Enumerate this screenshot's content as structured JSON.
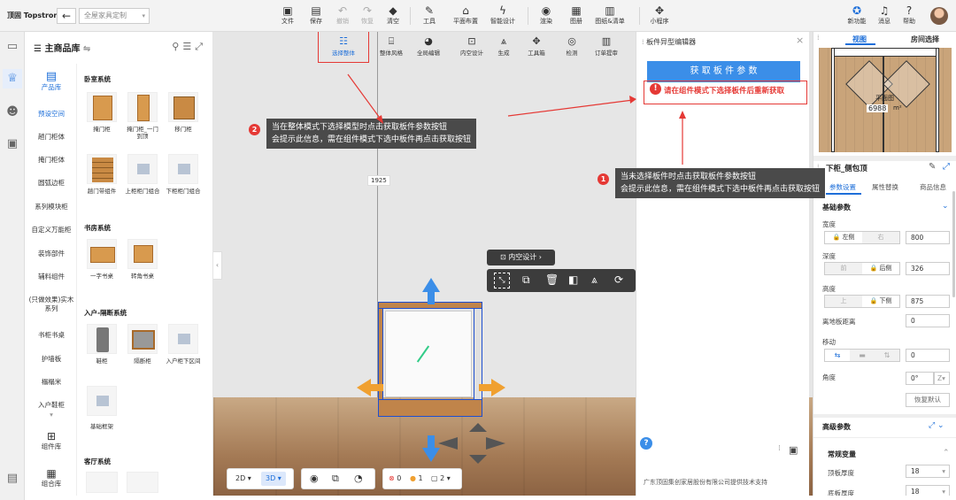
{
  "topbar": {
    "logo": "顶固 Topstrong",
    "back_icon": "arrow-left-icon",
    "plan_name": "全屋家具定制",
    "tools": [
      {
        "label": "文件",
        "icon": "file-icon"
      },
      {
        "label": "保存",
        "icon": "save-icon"
      },
      {
        "label": "撤销",
        "icon": "undo-icon"
      },
      {
        "label": "恢复",
        "icon": "redo-icon"
      },
      {
        "label": "清空",
        "icon": "eraser-icon"
      },
      {
        "label": "工具",
        "icon": "tool-icon"
      },
      {
        "label": "平面布置",
        "icon": "layout-icon"
      },
      {
        "label": "智能设计",
        "icon": "lightning-icon"
      },
      {
        "label": "渲染",
        "icon": "camera-icon"
      },
      {
        "label": "图册",
        "icon": "album-icon"
      },
      {
        "label": "图纸&清单",
        "icon": "drawing-icon"
      },
      {
        "label": "小程序",
        "icon": "puzzle-icon"
      }
    ],
    "right": [
      {
        "label": "新功能",
        "icon": "bulb-icon"
      },
      {
        "label": "消息",
        "icon": "bell-icon"
      },
      {
        "label": "帮助",
        "icon": "help-icon"
      }
    ]
  },
  "library": {
    "title": "主商品库",
    "categories": [
      "产品库",
      "预设空间",
      "趟门柜体",
      "掩门柜体",
      "圆弧边柜",
      "系列模块柜",
      "自定义万能柜",
      "装饰部件",
      "辅料组件",
      "(只做效果)实木系列",
      "书柜书桌",
      "护墙板",
      "榻榻米",
      "入户鞋柜",
      "组件库",
      "组合库"
    ],
    "sections": [
      {
        "title": "卧室系统",
        "items": [
          "掩门柜",
          "掩门柜_一门到顶",
          "移门柜",
          "趟门带组件",
          "上柜柜门组合",
          "下柜柜门组合"
        ]
      },
      {
        "title": "书房系统",
        "items": [
          "一字书桌",
          "转角书桌"
        ]
      },
      {
        "title": "入户-隔断系统",
        "items": [
          "鞋柜",
          "隔断柜",
          "入户柜下区间",
          "基础框架"
        ]
      },
      {
        "title": "客厅系统",
        "items": []
      }
    ]
  },
  "viewport": {
    "tools": [
      {
        "label": "选择整体",
        "icon": "select-icon"
      },
      {
        "label": "整体风格",
        "icon": "style-icon"
      },
      {
        "label": "全局编辑",
        "icon": "global-edit-icon"
      },
      {
        "label": "内空设计",
        "icon": "interior-icon"
      },
      {
        "label": "生成",
        "icon": "generate-icon"
      },
      {
        "label": "工具箱",
        "icon": "toolbox-icon"
      },
      {
        "label": "检测",
        "icon": "detect-icon"
      },
      {
        "label": "订单提审",
        "icon": "order-icon"
      }
    ],
    "dimension": "1925",
    "annot1_line1": "当未选择板件时点击获取板件参数按钮",
    "annot1_line2": "会提示此信息，需在组件模式下选中板件再点击获取按钮",
    "annot2_line1": "当在整体模式下选择模型时点击获取板件参数按钮",
    "annot2_line2": "会提示此信息，需在组件模式下选中板件再点击获取按钮",
    "badge1": "1",
    "badge2": "2",
    "interior_btn": "内空设计",
    "view2d": "2D",
    "view3d": "3D",
    "err_count": "0",
    "warn_count": "1",
    "layer_count": "2"
  },
  "panel": {
    "title": "板件异型编辑器",
    "fetch_btn": "获 取 板 件 参 数",
    "error_msg": "请在组件模式下选择板件后重新获取",
    "footer": "广东顶固集创家居股份有限公司提供技术支持"
  },
  "props": {
    "tabs": [
      "视图",
      "房间选择"
    ],
    "room_area": "6988",
    "room_label": "平面图",
    "room_unit": "m²",
    "title": "下柜_侧包顶",
    "subtabs": [
      "参数设置",
      "属性替换",
      "商品信息"
    ],
    "basic": "基础参数",
    "width_label": "宽度",
    "width_seg": [
      "左侧",
      "右"
    ],
    "width_val": "800",
    "depth_label": "深度",
    "depth_seg": [
      "前",
      "后侧"
    ],
    "depth_val": "326",
    "height_label": "高度",
    "height_seg": [
      "上",
      "下侧"
    ],
    "height_val": "875",
    "ground_label": "离地板距离",
    "ground_val": "0",
    "move_label": "移动",
    "move_val": "0",
    "angle_label": "角度",
    "angle_val": "0°",
    "axis": "Z",
    "reset_btn": "恢复默认",
    "advanced": "高级参数",
    "common": "常规变量",
    "top_thick_label": "顶板厚度",
    "top_thick_val": "18",
    "bottom_thick_label": "底板厚度",
    "bottom_thick_val": "18"
  },
  "colors": {
    "accent": "#1e6fd9",
    "panel_blue": "#3b8ee8",
    "error": "#e53935",
    "cabinet": "#c0844a",
    "annot_bg": "#4a4a4a"
  }
}
